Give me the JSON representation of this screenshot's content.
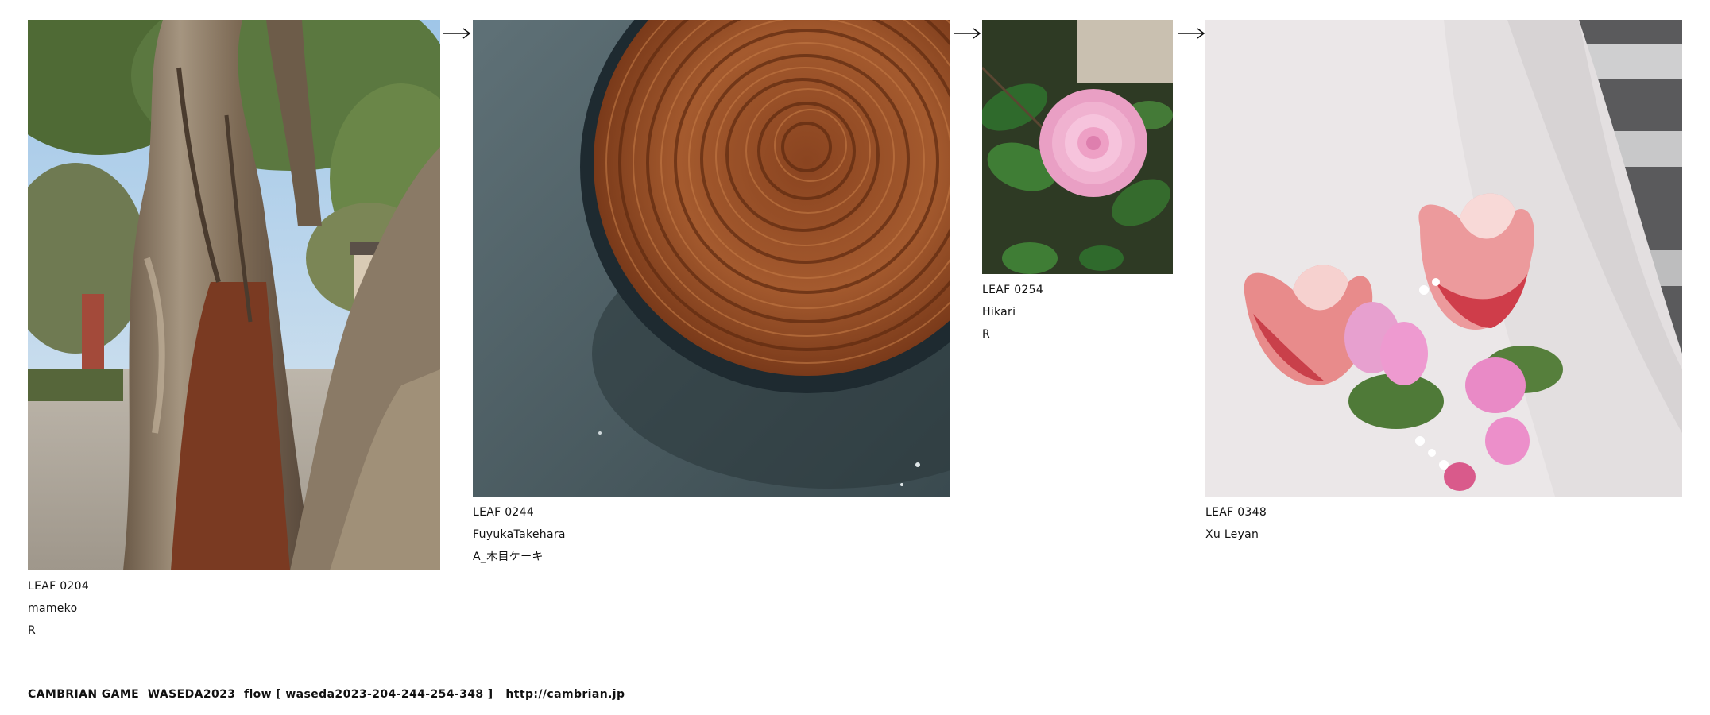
{
  "leaves": [
    {
      "id": "LEAF 0204",
      "author": "mameko",
      "title": "R",
      "subject": "old tree trunk in temple grounds"
    },
    {
      "id": "LEAF 0244",
      "author": "FuyukaTakehara",
      "title": "A_木目ケーキ",
      "subject": "chocolate rose-swirl cake on dark plate"
    },
    {
      "id": "LEAF 0254",
      "author": "Hikari",
      "title": "R",
      "subject": "pink camellia flower among leaves"
    },
    {
      "id": "LEAF 0348",
      "author": "Xu Leyan",
      "title": "",
      "subject": "tulip bouquet wrapped in white paper"
    }
  ],
  "footer": {
    "text": "CAMBRIAN GAME  WASEDA2023  flow [ waseda2023-204-244-254-348 ]   http://cambrian.jp"
  },
  "colors": {
    "text": "#111111",
    "background": "#ffffff"
  }
}
